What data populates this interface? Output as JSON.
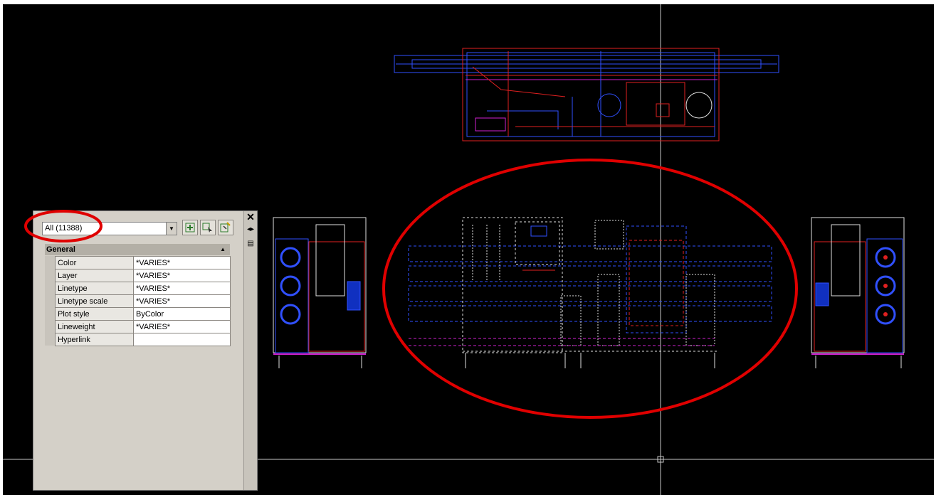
{
  "palette": {
    "selection": "All (11388)",
    "section_title": "General",
    "properties": [
      {
        "name": "Color",
        "value": "*VARIES*"
      },
      {
        "name": "Layer",
        "value": "*VARIES*"
      },
      {
        "name": "Linetype",
        "value": "*VARIES*"
      },
      {
        "name": "Linetype scale",
        "value": "*VARIES*"
      },
      {
        "name": "Plot style",
        "value": "ByColor"
      },
      {
        "name": "Lineweight",
        "value": "*VARIES*"
      },
      {
        "name": "Hyperlink",
        "value": ""
      }
    ],
    "close_glyph": "✕",
    "toolbar_icons": [
      "quick-select-icon",
      "select-objects-icon",
      "toggle-pickadd-icon"
    ]
  },
  "colors": {
    "canvas": "#000000",
    "annotation": "#e00000",
    "cad_blue": "#3050ff",
    "cad_red": "#e02020",
    "cad_magenta": "#d020d0",
    "cad_white": "#e0e0e0",
    "crosshair": "#c8c8c8"
  }
}
